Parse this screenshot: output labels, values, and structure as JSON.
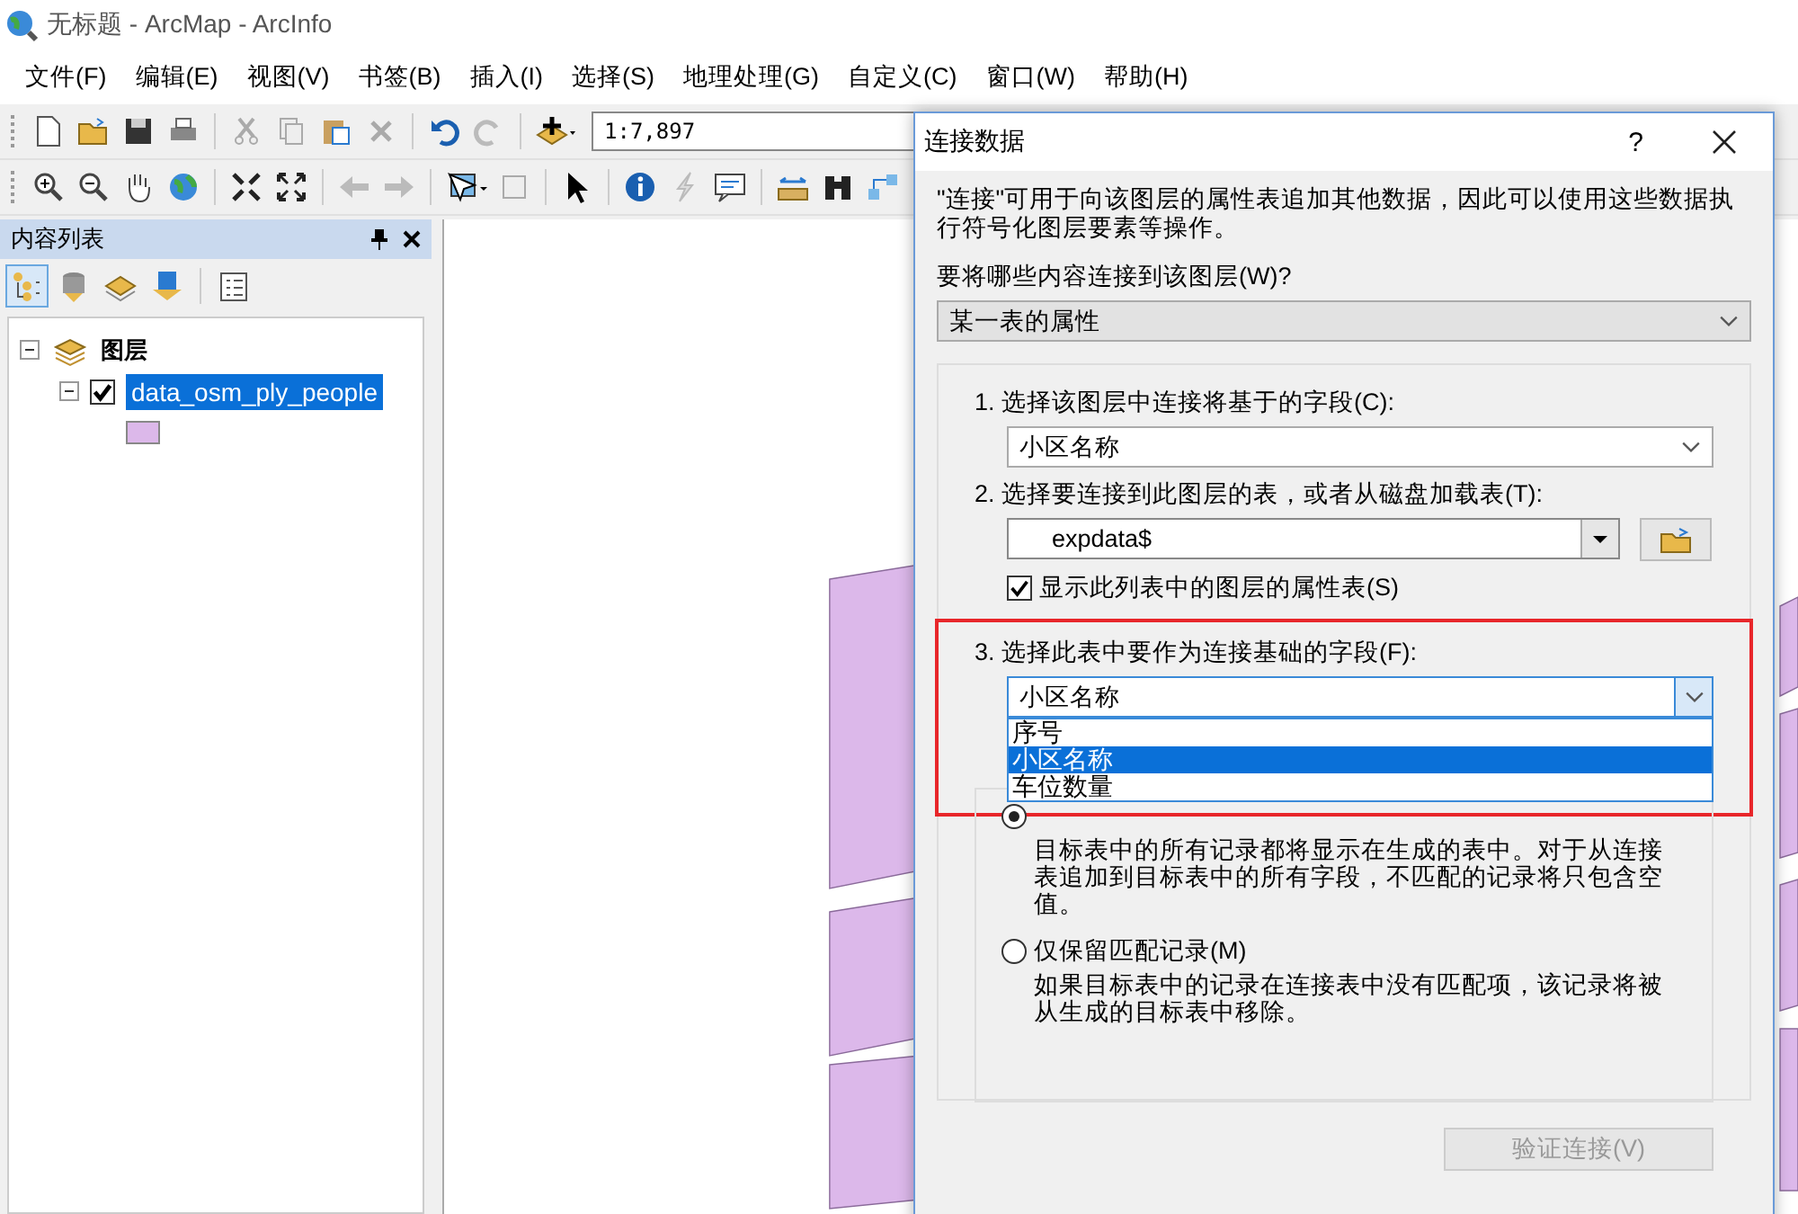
{
  "window": {
    "title": "无标题 - ArcMap - ArcInfo"
  },
  "menu": [
    "文件(F)",
    "编辑(E)",
    "视图(V)",
    "书签(B)",
    "插入(I)",
    "选择(S)",
    "地理处理(G)",
    "自定义(C)",
    "窗口(W)",
    "帮助(H)"
  ],
  "toolbar": {
    "scale": "1:7,897"
  },
  "toc": {
    "title": "内容列表",
    "layers": [
      {
        "label": "图层",
        "expanded": true,
        "children": [
          {
            "label": "data_osm_ply_people",
            "checked": true,
            "selected": true,
            "expanded": true,
            "color": "#dcb8ea"
          }
        ]
      }
    ]
  },
  "dialog": {
    "title": "连接数据",
    "help": "?",
    "description": "\"连接\"可用于向该图层的属性表追加其他数据，因此可以使用这些数据执行符号化图层要素等操作。",
    "source_label": "要将哪些内容连接到该图层(W)?",
    "source_value": "某一表的属性",
    "step_1": {
      "label": "1. 选择该图层中连接将基于的字段(C):",
      "value": "小区名称"
    },
    "step_2": {
      "label": "2. 选择要连接到此图层的表，或者从磁盘加载表(T):",
      "value": "expdata$",
      "show_layers": {
        "label": "显示此列表中的图层的属性表(S)",
        "checked": true
      }
    },
    "step_3": {
      "label": "3. 选择此表中要作为连接基础的字段(F):",
      "value": "小区名称",
      "open": true,
      "options": [
        {
          "label": "序号",
          "selected": false
        },
        {
          "label": "小区名称",
          "selected": true
        },
        {
          "label": "车位数量",
          "selected": false
        }
      ]
    },
    "join_options": [
      {
        "selected": true,
        "description": "目标表中的所有记录都将显示在生成的表中。对于从连接表追加到目标表中的所有字段，不匹配的记录将只包含空值。"
      },
      {
        "label": "仅保留匹配记录(M)",
        "selected": false,
        "description": "如果目标表中的记录在连接表中没有匹配项，该记录将被从生成的目标表中移除。"
      }
    ],
    "validate_button": {
      "label": "验证连接(V)",
      "disabled": true
    }
  }
}
